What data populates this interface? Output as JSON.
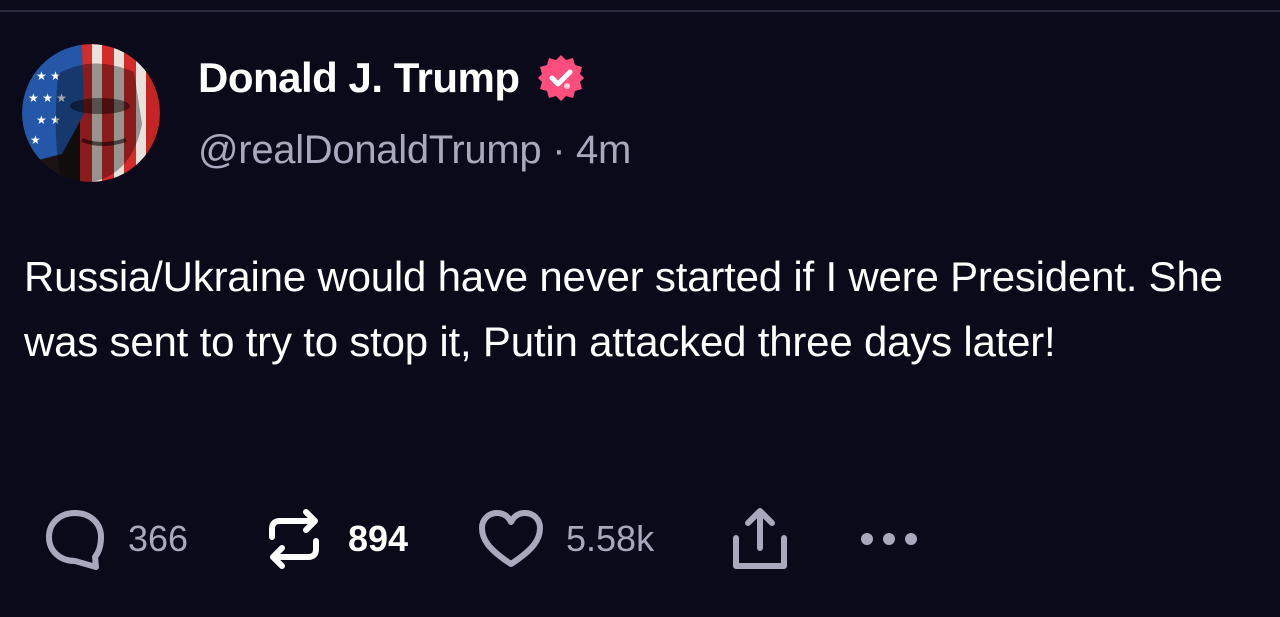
{
  "post": {
    "author": {
      "display_name": "Donald J. Trump",
      "handle": "@realDonaldTrump",
      "separator": "·",
      "time": "4m",
      "verified_icon": "verified-badge-icon",
      "verified_color": "#ff4d7e"
    },
    "body": "Russia/Ukraine would have never started if I were President. She was sent to try to stop it, Putin attacked three days later!",
    "actions": {
      "replies": {
        "icon": "comment-icon",
        "count": "366"
      },
      "reposts": {
        "icon": "repost-icon",
        "count": "894"
      },
      "likes": {
        "icon": "heart-icon",
        "count": "5.58k"
      },
      "share": {
        "icon": "share-icon"
      },
      "more": {
        "icon": "more-options-icon"
      }
    }
  },
  "colors": {
    "background": "#0b0a1a",
    "text_primary": "#ffffff",
    "text_secondary": "#a9a8bd",
    "icon": "#a9a8bd"
  }
}
